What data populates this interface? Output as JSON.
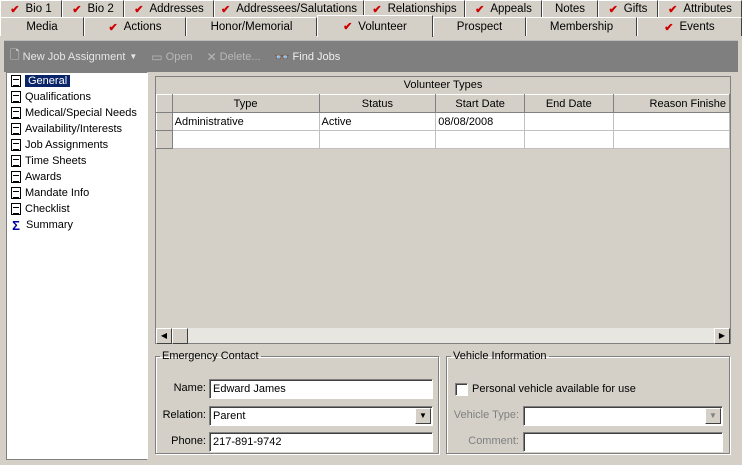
{
  "tabs_row1": [
    {
      "label": "Bio 1",
      "checked": true
    },
    {
      "label": "Bio 2",
      "checked": true
    },
    {
      "label": "Addresses",
      "checked": true
    },
    {
      "label": "Addressees/Salutations",
      "checked": true
    },
    {
      "label": "Relationships",
      "checked": true
    },
    {
      "label": "Appeals",
      "checked": true
    },
    {
      "label": "Notes",
      "checked": false
    },
    {
      "label": "Gifts",
      "checked": true
    },
    {
      "label": "Attributes",
      "checked": true
    }
  ],
  "tabs_row2": [
    {
      "label": "Media",
      "checked": false
    },
    {
      "label": "Actions",
      "checked": true
    },
    {
      "label": "Honor/Memorial",
      "checked": false
    },
    {
      "label": "Volunteer",
      "checked": true,
      "active": true
    },
    {
      "label": "Prospect",
      "checked": false
    },
    {
      "label": "Membership",
      "checked": false
    },
    {
      "label": "Events",
      "checked": true
    }
  ],
  "toolbar": {
    "new_job": "New Job Assignment",
    "open": "Open",
    "delete": "Delete...",
    "find_jobs": "Find Jobs"
  },
  "nav": [
    {
      "label": "General",
      "icon": "document-icon",
      "selected": true
    },
    {
      "label": "Qualifications",
      "icon": "document-icon"
    },
    {
      "label": "Medical/Special Needs",
      "icon": "document-icon"
    },
    {
      "label": "Availability/Interests",
      "icon": "document-icon"
    },
    {
      "label": "Job Assignments",
      "icon": "document-icon"
    },
    {
      "label": "Time Sheets",
      "icon": "document-icon"
    },
    {
      "label": "Awards",
      "icon": "document-icon"
    },
    {
      "label": "Mandate Info",
      "icon": "document-icon"
    },
    {
      "label": "Checklist",
      "icon": "document-icon"
    },
    {
      "label": "Summary",
      "icon": "sigma-icon"
    }
  ],
  "volunteer_types": {
    "title": "Volunteer Types",
    "columns": [
      "Type",
      "Status",
      "Start Date",
      "End Date",
      "Reason Finishe"
    ],
    "rows": [
      [
        "Administrative",
        "Active",
        "08/08/2008",
        "",
        ""
      ],
      [
        "",
        "",
        "",
        "",
        ""
      ]
    ]
  },
  "emergency_contact": {
    "legend": "Emergency Contact",
    "name_label": "Name:",
    "name_value": "Edward James",
    "relation_label": "Relation:",
    "relation_value": "Parent",
    "phone_label": "Phone:",
    "phone_value": "217-891-9742"
  },
  "vehicle": {
    "legend": "Vehicle Information",
    "personal_label": "Personal vehicle available for use",
    "personal_checked": false,
    "type_label": "Vehicle Type:",
    "type_value": "",
    "comment_label": "Comment:",
    "comment_value": ""
  },
  "colors": {
    "check": "#d00000",
    "selection": "#0a246a",
    "toolbar": "#7f7f7f",
    "face": "#d4d0c8"
  }
}
